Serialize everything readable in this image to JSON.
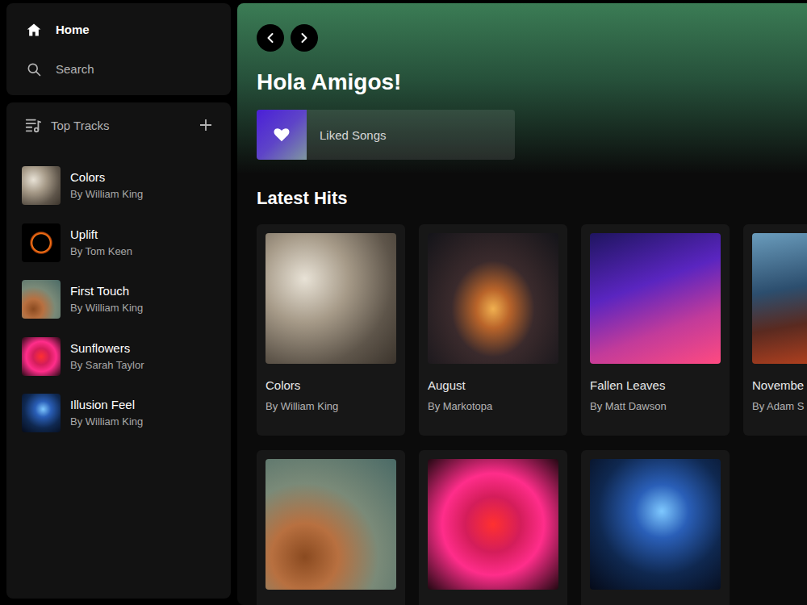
{
  "nav": {
    "items": [
      {
        "label": "Home",
        "selected": true
      },
      {
        "label": "Search",
        "selected": false
      }
    ]
  },
  "library": {
    "title": "Top Tracks",
    "tracks": [
      {
        "title": "Colors",
        "artist": "By William King"
      },
      {
        "title": "Uplift",
        "artist": "By Tom Keen"
      },
      {
        "title": "First Touch",
        "artist": "By William King"
      },
      {
        "title": "Sunflowers",
        "artist": "By Sarah Taylor"
      },
      {
        "title": "Illusion Feel",
        "artist": "By William King"
      }
    ]
  },
  "header": {
    "greeting": "Hola Amigos!",
    "liked": {
      "label": "Liked Songs"
    }
  },
  "latest_hits": {
    "title": "Latest Hits",
    "cards": [
      {
        "kind": "captioned",
        "title": "Colors",
        "artist": "By William King"
      },
      {
        "kind": "captioned",
        "title": "August",
        "artist": "By Markotopa"
      },
      {
        "kind": "captioned",
        "title": "Fallen Leaves",
        "artist": "By Matt Dawson"
      },
      {
        "kind": "captioned",
        "title": "Novembe",
        "artist": "By Adam S"
      },
      {
        "kind": "image-only"
      },
      {
        "kind": "image-only"
      },
      {
        "kind": "image-only"
      }
    ]
  }
}
